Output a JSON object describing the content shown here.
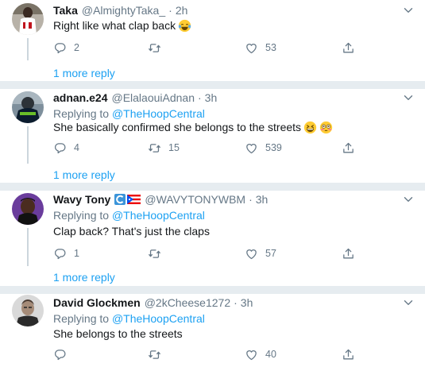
{
  "tweets": [
    {
      "name": "Taka",
      "handle": "@AlmightyTaka_",
      "dot": "·",
      "time": "2h",
      "text": "Right like what clap back",
      "emoji": [
        "face-with-tears-of-joy"
      ],
      "replies": "2",
      "retweets": "",
      "likes": "53",
      "more_replies": "1 more reply"
    },
    {
      "name": "adnan.e24",
      "handle": "@ElalaouiAdnan",
      "dot": "·",
      "time": "3h",
      "replying_prefix": "Replying to",
      "replying_to": "@TheHoopCentral",
      "text": "She basically confirmed she belongs to the streets",
      "emoji": [
        "grinning-squinting-face",
        "flushed-face"
      ],
      "replies": "4",
      "retweets": "15",
      "likes": "539",
      "more_replies": "1 more reply"
    },
    {
      "name": "Wavy Tony",
      "badges": [
        "crescent-c-icon",
        "puerto-rico-flag-icon"
      ],
      "handle": "@WAVYTONYWBM",
      "dot": "·",
      "time": "3h",
      "replying_prefix": "Replying to",
      "replying_to": "@TheHoopCentral",
      "text": "Clap back? That's just the claps",
      "replies": "1",
      "retweets": "",
      "likes": "57",
      "more_replies": "1 more reply"
    },
    {
      "name": "David Glockmen",
      "handle": "@2kCheese1272",
      "dot": "·",
      "time": "3h",
      "replying_prefix": "Replying to",
      "replying_to": "@TheHoopCentral",
      "text": "She belongs to the streets",
      "replies": "",
      "retweets": "",
      "likes": "40"
    }
  ],
  "colors": {
    "accent": "#1da1f2",
    "secondary_text": "#657786",
    "separator": "#e6ecf0",
    "thread_line": "#ccd6dd"
  }
}
